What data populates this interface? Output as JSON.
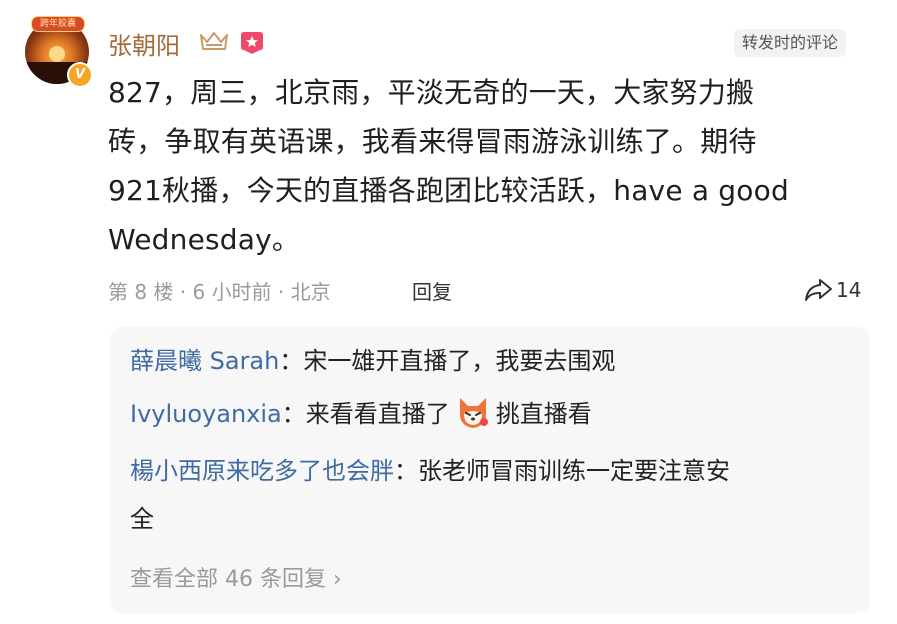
{
  "comment": {
    "username": "张朝阳",
    "avatar_badge_text": "跨年胶囊",
    "verified_mark": "V",
    "repost_tag": "转发时的评论",
    "content_lines": [
      "827，周三，北京雨，平淡无奇的一天，大家努力搬",
      "砖，争取有英语课，我看来得冒雨游泳训练了。期待",
      "921秋播，今天的直播各跑团比较活跃，have a good",
      "Wednesday。"
    ],
    "meta": "第 8 楼 · 6 小时前 · 北京",
    "reply_label": "回复",
    "share_count": "14"
  },
  "replies": [
    {
      "name": "薛晨曦 Sarah",
      "sep": "：",
      "text": "宋一雄开直播了，我要去围观"
    },
    {
      "name": "Ivyluoyanxia",
      "sep": "：",
      "text_before": "来看看直播了",
      "emoji": "fox-emoji",
      "text_after": "挑直播看"
    },
    {
      "name": "楊小西原来吃多了也会胖",
      "sep": "：",
      "text_line1": "张老师冒雨训练一定要注意安",
      "text_line2": "全"
    }
  ],
  "view_all": "查看全部 46 条回复 ›",
  "colors": {
    "username": "#a46a3a",
    "reply_name": "#3f6aa3",
    "muted": "#9a9a9a"
  }
}
